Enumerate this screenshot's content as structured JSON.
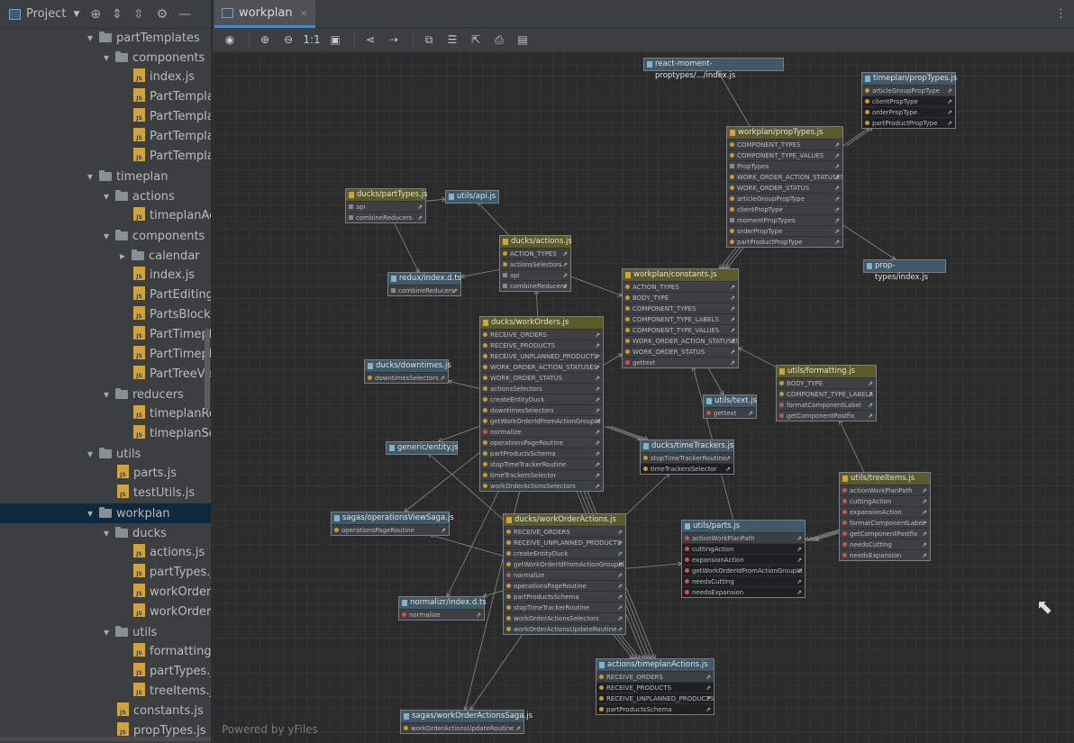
{
  "sidebar": {
    "title": "Project",
    "tree": [
      {
        "label": "partTemplates",
        "kind": "folder",
        "open": true,
        "depth": 0
      },
      {
        "label": "components",
        "kind": "folder",
        "open": true,
        "depth": 1
      },
      {
        "label": "index.js",
        "kind": "js",
        "depth": 2
      },
      {
        "label": "PartTempla",
        "kind": "js",
        "depth": 2
      },
      {
        "label": "PartTempla",
        "kind": "js",
        "depth": 2
      },
      {
        "label": "PartTempla",
        "kind": "js",
        "depth": 2
      },
      {
        "label": "PartTempla",
        "kind": "js",
        "depth": 2
      },
      {
        "label": "timeplan",
        "kind": "folder",
        "open": true,
        "depth": 0
      },
      {
        "label": "actions",
        "kind": "folder",
        "open": true,
        "depth": 1
      },
      {
        "label": "timeplanAc",
        "kind": "js",
        "depth": 2
      },
      {
        "label": "components",
        "kind": "folder",
        "open": true,
        "depth": 1
      },
      {
        "label": "calendar",
        "kind": "folder",
        "open": false,
        "depth": 2
      },
      {
        "label": "index.js",
        "kind": "js",
        "depth": 2
      },
      {
        "label": "PartEditing",
        "kind": "js",
        "depth": 2
      },
      {
        "label": "PartsBlocke",
        "kind": "js",
        "depth": 2
      },
      {
        "label": "PartTimepla",
        "kind": "js",
        "depth": 2
      },
      {
        "label": "PartTimepla",
        "kind": "js",
        "depth": 2
      },
      {
        "label": "PartTreeVie",
        "kind": "js",
        "depth": 2
      },
      {
        "label": "reducers",
        "kind": "folder",
        "open": true,
        "depth": 1
      },
      {
        "label": "timeplanRe",
        "kind": "js",
        "depth": 2
      },
      {
        "label": "timeplanSe",
        "kind": "js",
        "depth": 2
      },
      {
        "label": "utils",
        "kind": "folder",
        "open": true,
        "depth": 0
      },
      {
        "label": "parts.js",
        "kind": "js",
        "depth": 1
      },
      {
        "label": "testUtils.js",
        "kind": "js",
        "depth": 1
      },
      {
        "label": "workplan",
        "kind": "folder",
        "open": true,
        "depth": 0,
        "selected": true
      },
      {
        "label": "ducks",
        "kind": "folder",
        "open": true,
        "depth": 1
      },
      {
        "label": "actions.js",
        "kind": "js",
        "depth": 2
      },
      {
        "label": "partTypes.j",
        "kind": "js",
        "depth": 2
      },
      {
        "label": "workOrderA",
        "kind": "js",
        "depth": 2
      },
      {
        "label": "workOrders",
        "kind": "js",
        "depth": 2
      },
      {
        "label": "utils",
        "kind": "folder",
        "open": true,
        "depth": 1
      },
      {
        "label": "formatting.",
        "kind": "js",
        "depth": 2
      },
      {
        "label": "partTypes.j",
        "kind": "js",
        "depth": 2
      },
      {
        "label": "treeItems.js",
        "kind": "js",
        "depth": 2
      },
      {
        "label": "constants.js",
        "kind": "js",
        "depth": 1
      },
      {
        "label": "propTypes.js",
        "kind": "js",
        "depth": 1
      }
    ]
  },
  "editor": {
    "tab_label": "workplan",
    "tab_close": "×",
    "kebab": "⋮"
  },
  "toolbar": {
    "buttons": [
      {
        "name": "view-toggle-button",
        "glyph": "◉"
      },
      {
        "sep": true
      },
      {
        "name": "zoom-in-button",
        "glyph": "⊕"
      },
      {
        "name": "zoom-out-button",
        "glyph": "⊖"
      },
      {
        "name": "actual-size-button",
        "glyph": "1:1"
      },
      {
        "name": "fit-content-button",
        "glyph": "▣"
      },
      {
        "sep": true
      },
      {
        "name": "layout-button",
        "glyph": "⋖"
      },
      {
        "name": "apply-layout-button",
        "glyph": "⇢"
      },
      {
        "sep": true
      },
      {
        "name": "copy-button",
        "glyph": "⧉"
      },
      {
        "name": "structure-button",
        "glyph": "☰"
      },
      {
        "name": "export-button",
        "glyph": "⇱"
      },
      {
        "name": "print-button",
        "glyph": "⎙"
      },
      {
        "name": "save-button",
        "glyph": "▤"
      }
    ]
  },
  "diagram": {
    "watermark": "Powered by yFiles",
    "nodes": [
      {
        "id": "rmpt",
        "title": "react-moment-proptypes/.../index.js",
        "color": "b",
        "items": []
      },
      {
        "id": "tpp",
        "title": "timeplan/propTypes.js",
        "color": "b",
        "items": [
          {
            "t": "articleGroupPropType"
          },
          {
            "t": "clientPropType",
            "hl": true
          },
          {
            "t": "orderPropType",
            "hl": true
          },
          {
            "t": "partProductPropType",
            "hl": true
          }
        ]
      },
      {
        "id": "wpp",
        "title": "workplan/propTypes.js",
        "color": "y",
        "items": [
          {
            "t": "COMPONENT_TYPES"
          },
          {
            "t": "COMPONENT_TYPE_VALUES"
          },
          {
            "t": "PropTypes",
            "f": true
          },
          {
            "t": "WORK_ORDER_ACTION_STATUSES"
          },
          {
            "t": "WORK_ORDER_STATUS"
          },
          {
            "t": "articleGroupPropType"
          },
          {
            "t": "clientPropType"
          },
          {
            "t": "momentPropTypes",
            "f": true
          },
          {
            "t": "orderPropType"
          },
          {
            "t": "partProductPropType"
          }
        ]
      },
      {
        "id": "dpt",
        "title": "ducks/partTypes.js",
        "color": "y",
        "items": [
          {
            "t": "api",
            "f": true
          },
          {
            "t": "combineReducers",
            "f": true
          }
        ]
      },
      {
        "id": "uapi",
        "title": "utils/api.js",
        "color": "b",
        "items": []
      },
      {
        "id": "dact",
        "title": "ducks/actions.js",
        "color": "y",
        "items": [
          {
            "t": "ACTION_TYPES"
          },
          {
            "t": "actionsSelectors"
          },
          {
            "t": "api",
            "f": true
          },
          {
            "t": "combineReducers",
            "f": true
          }
        ]
      },
      {
        "id": "redux",
        "title": "redux/index.d.ts",
        "color": "b",
        "items": [
          {
            "t": "combineReducers",
            "f": true
          }
        ]
      },
      {
        "id": "wcon",
        "title": "workplan/constants.js",
        "color": "y",
        "items": [
          {
            "t": "ACTION_TYPES"
          },
          {
            "t": "BODY_TYPE"
          },
          {
            "t": "COMPONENT_TYPES"
          },
          {
            "t": "COMPONENT_TYPE_LABELS"
          },
          {
            "t": "COMPONENT_TYPE_VALUES"
          },
          {
            "t": "WORK_ORDER_ACTION_STATUSES"
          },
          {
            "t": "WORK_ORDER_STATUS"
          },
          {
            "t": "gettext",
            "red": true
          }
        ]
      },
      {
        "id": "ptidx",
        "title": "prop-types/index.js",
        "color": "b",
        "items": []
      },
      {
        "id": "dwo",
        "title": "ducks/workOrders.js",
        "color": "y",
        "items": [
          {
            "t": "RECEIVE_ORDERS"
          },
          {
            "t": "RECEIVE_PRODUCTS"
          },
          {
            "t": "RECEIVE_UNPLANNED_PRODUCTS"
          },
          {
            "t": "WORK_ORDER_ACTION_STATUSES"
          },
          {
            "t": "WORK_ORDER_STATUS"
          },
          {
            "t": "actionsSelectors"
          },
          {
            "t": "createEntityDuck"
          },
          {
            "t": "downtimesSelectors"
          },
          {
            "t": "getWorkOrderIdFromActionGroupId"
          },
          {
            "t": "normalize",
            "red": true
          },
          {
            "t": "operationsPageRoutine"
          },
          {
            "t": "partProductsSchema"
          },
          {
            "t": "stopTimeTrackerRoutine"
          },
          {
            "t": "timeTrackersSelector"
          },
          {
            "t": "workOrderActionsSelectors"
          }
        ]
      },
      {
        "id": "ddown",
        "title": "ducks/downtimes.js",
        "color": "b",
        "items": [
          {
            "t": "downtimesSelectors"
          }
        ]
      },
      {
        "id": "utext",
        "title": "utils/text.js",
        "color": "b",
        "items": [
          {
            "t": "gettext",
            "red": true
          }
        ]
      },
      {
        "id": "ufmt",
        "title": "utils/formatting.js",
        "color": "y",
        "items": [
          {
            "t": "BODY_TYPE"
          },
          {
            "t": "COMPONENT_TYPE_LABELS"
          },
          {
            "t": "formatComponentLabel",
            "red": true
          },
          {
            "t": "getComponentPostfix",
            "red": true
          }
        ]
      },
      {
        "id": "gent",
        "title": "generic/entity.js",
        "color": "b",
        "items": []
      },
      {
        "id": "dtt",
        "title": "ducks/timeTrackers.js",
        "color": "b",
        "items": [
          {
            "t": "stopTimeTrackerRoutine"
          },
          {
            "t": "timeTrackersSelector",
            "hl": true
          }
        ]
      },
      {
        "id": "uti",
        "title": "utils/treeItems.js",
        "color": "y",
        "items": [
          {
            "t": "actionWorkPlanPath",
            "red": true
          },
          {
            "t": "cuttingAction",
            "red": true
          },
          {
            "t": "expansionAction",
            "red": true
          },
          {
            "t": "formatComponentLabel",
            "red": true
          },
          {
            "t": "getComponentPostfix",
            "red": true
          },
          {
            "t": "needsCutting",
            "red": true
          },
          {
            "t": "needsExpansion",
            "red": true
          }
        ]
      },
      {
        "id": "sovs",
        "title": "sagas/operationsViewSaga.js",
        "color": "b",
        "items": [
          {
            "t": "operationsPageRoutine"
          }
        ]
      },
      {
        "id": "dwoa",
        "title": "ducks/workOrderActions.js",
        "color": "y",
        "items": [
          {
            "t": "RECEIVE_ORDERS"
          },
          {
            "t": "RECEIVE_UNPLANNED_PRODUCTS"
          },
          {
            "t": "createEntityDuck"
          },
          {
            "t": "getWorkOrderIdFromActionGroupId"
          },
          {
            "t": "normalize",
            "red": true
          },
          {
            "t": "operationsPageRoutine"
          },
          {
            "t": "partProductsSchema"
          },
          {
            "t": "stopTimeTrackerRoutine"
          },
          {
            "t": "workOrderActionsSelectors"
          },
          {
            "t": "workOrderActionsUpdateRoutine"
          }
        ]
      },
      {
        "id": "uparts",
        "title": "utils/parts.js",
        "color": "b",
        "items": [
          {
            "t": "actionWorkPlanPath",
            "red": true
          },
          {
            "t": "cuttingAction",
            "red": true,
            "hl": true
          },
          {
            "t": "expansionAction",
            "red": true,
            "hl": true
          },
          {
            "t": "getWorkOrderIdFromActionGroupId",
            "red": true,
            "hl": true
          },
          {
            "t": "needsCutting",
            "red": true,
            "hl": true
          },
          {
            "t": "needsExpansion",
            "red": true,
            "hl": true
          }
        ]
      },
      {
        "id": "nrm",
        "title": "normalizr/index.d.ts",
        "color": "b",
        "items": [
          {
            "t": "normalize",
            "red": true
          }
        ]
      },
      {
        "id": "tpa",
        "title": "actions/timeplanActions.js",
        "color": "b",
        "items": [
          {
            "t": "RECEIVE_ORDERS"
          },
          {
            "t": "RECEIVE_PRODUCTS",
            "hl": true
          },
          {
            "t": "RECEIVE_UNPLANNED_PRODUCTS",
            "hl": true
          },
          {
            "t": "partProductsSchema",
            "hl": true
          }
        ]
      },
      {
        "id": "swoas",
        "title": "sagas/workOrderActionsSaga.js",
        "color": "b",
        "items": [
          {
            "t": "workOrderActionsUpdateRoutine"
          }
        ]
      }
    ]
  }
}
